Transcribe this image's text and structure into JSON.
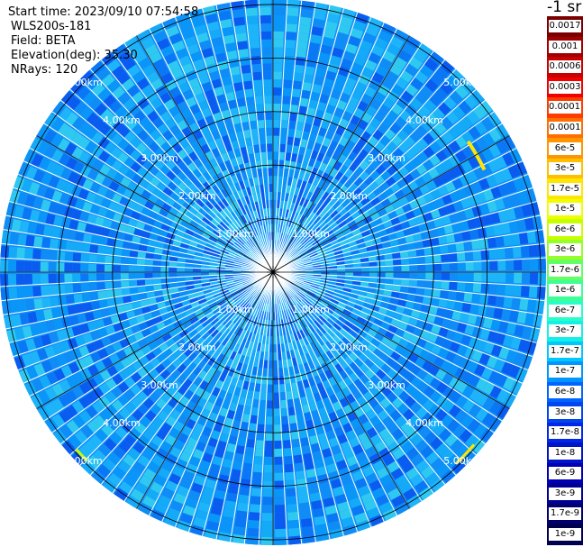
{
  "header": {
    "start_time": "Start time: 2023/09/10 07:54:58",
    "instrument": "WLS200s-181",
    "field": "Field: BETA",
    "elevation": "Elevation(deg): 35.30",
    "nrays": "NRays: 120"
  },
  "colorbar": {
    "title": "-1 sr",
    "levels": [
      "0.0017",
      "0.001",
      "0.0006",
      "0.0003",
      "0.00017",
      "0.0001",
      "6e-5",
      "3e-5",
      "1.7e-5",
      "1e-5",
      "6e-6",
      "3e-6",
      "1.7e-6",
      "1e-6",
      "6e-7",
      "3e-7",
      "1.7e-7",
      "1e-7",
      "6e-8",
      "3e-8",
      "1.7e-8",
      "1e-8",
      "6e-9",
      "3e-9",
      "1.7e-9",
      "1e-9"
    ],
    "colors": [
      "#7a0000",
      "#a00000",
      "#c80000",
      "#f00000",
      "#ff3c00",
      "#ff6e00",
      "#ff9600",
      "#ffbe00",
      "#ffe600",
      "#f0ff00",
      "#c8ff00",
      "#96ff28",
      "#64ff64",
      "#3cff96",
      "#28ffc8",
      "#14f0e6",
      "#00c8ff",
      "#0096ff",
      "#0064ff",
      "#0046f0",
      "#0028e6",
      "#0014c8",
      "#0000b4",
      "#000096",
      "#00006e",
      "#000050"
    ]
  },
  "range_labels": [
    "1.00km",
    "2.00km",
    "3.00km",
    "4.00km",
    "5.00km"
  ],
  "plot": {
    "rings_km": [
      1,
      2,
      3,
      4,
      5
    ],
    "max_range_km": 5.1,
    "n_rays": 120,
    "spokes_deg": [
      0,
      30,
      60,
      90,
      120,
      150,
      180,
      210,
      240,
      270,
      300,
      330
    ],
    "background_colors": [
      "#0a5cf0",
      "#0a78f5",
      "#0a96f8",
      "#14aaf8",
      "#1eb4fa",
      "#0f8cf5",
      "#2ec8f0"
    ]
  }
}
